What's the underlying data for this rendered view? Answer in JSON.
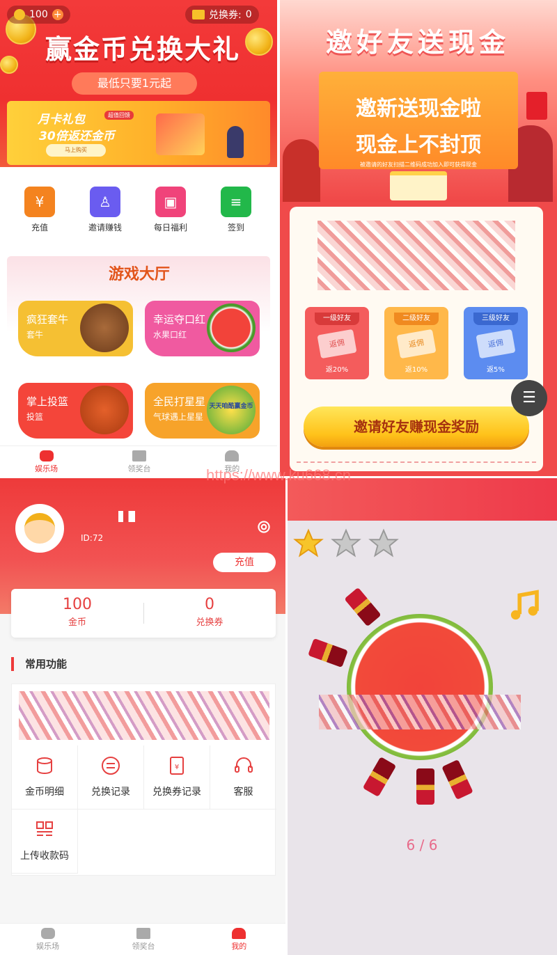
{
  "watermark": "https://www.ku668.cn",
  "screen1": {
    "coins": "100",
    "voucher_label": "兑换券:",
    "voucher_value": "0",
    "hero_title": "赢金币兑换大礼",
    "hero_sub": "最低只要1元起",
    "banner": {
      "line1": "月卡礼包",
      "line2": "30倍返还金币",
      "tag": "超值回馈",
      "button": "马上购买"
    },
    "shortcuts": [
      {
        "label": "充值",
        "color": "#f4831f",
        "icon": "money-bag-icon"
      },
      {
        "label": "邀请赚钱",
        "color": "#6a5cf0",
        "icon": "invite-user-icon"
      },
      {
        "label": "每日福利",
        "color": "#f0437a",
        "icon": "gift-icon"
      },
      {
        "label": "签到",
        "color": "#22b84a",
        "icon": "coin-stack-icon"
      }
    ],
    "hall_title": "游戏大厅",
    "games": [
      {
        "name": "疯狂套牛",
        "sub": "套牛",
        "color": "#f5c033"
      },
      {
        "name": "幸运夺口红",
        "sub": "水果口红",
        "color": "#f05aa0"
      },
      {
        "name": "掌上投篮",
        "sub": "投篮",
        "color": "#f4453a"
      },
      {
        "name": "全民打星星",
        "sub": "气球遇上星星",
        "color": "#f7a32a",
        "badge": "天天咱酷赢金币"
      }
    ],
    "tabs": [
      "娱乐场",
      "领奖台",
      "我的"
    ]
  },
  "screen2": {
    "title": "邀好友送现金",
    "board_line1": "邀新送现金啦",
    "board_line2": "现金上不封顶",
    "board_note": "被邀请的好友扫描二维码成功加入即可获得现金",
    "tiers": [
      {
        "head": "一级好友",
        "card": "返佣",
        "foot": "返20%",
        "color": "#f45c5c",
        "cardtext": "#e05050"
      },
      {
        "head": "二级好友",
        "card": "返佣",
        "foot": "返10%",
        "color": "#ffb84a",
        "cardtext": "#e88a20"
      },
      {
        "head": "三级好友",
        "card": "返佣",
        "foot": "返5%",
        "color": "#5c8cf0",
        "cardtext": "#4a72d8"
      }
    ],
    "invite_button": "邀请好友赚现金奖励"
  },
  "screen3": {
    "user_id": "ID:72",
    "recharge": "充值",
    "coins_value": "100",
    "coins_label": "金币",
    "voucher_value": "0",
    "voucher_label": "兑换券",
    "section_title": "常用功能",
    "functions": [
      {
        "label": "金币明细",
        "icon": "coin-db-icon"
      },
      {
        "label": "兑换记录",
        "icon": "exchange-icon"
      },
      {
        "label": "兑换券记录",
        "icon": "voucher-icon"
      },
      {
        "label": "客服",
        "icon": "headset-icon"
      },
      {
        "label": "上传收款码",
        "icon": "qrcode-icon"
      }
    ],
    "tabs": [
      "娱乐场",
      "领奖台",
      "我的"
    ]
  },
  "screen4": {
    "stars_earned": 1,
    "stars_total": 3,
    "progress": "6 / 6"
  }
}
